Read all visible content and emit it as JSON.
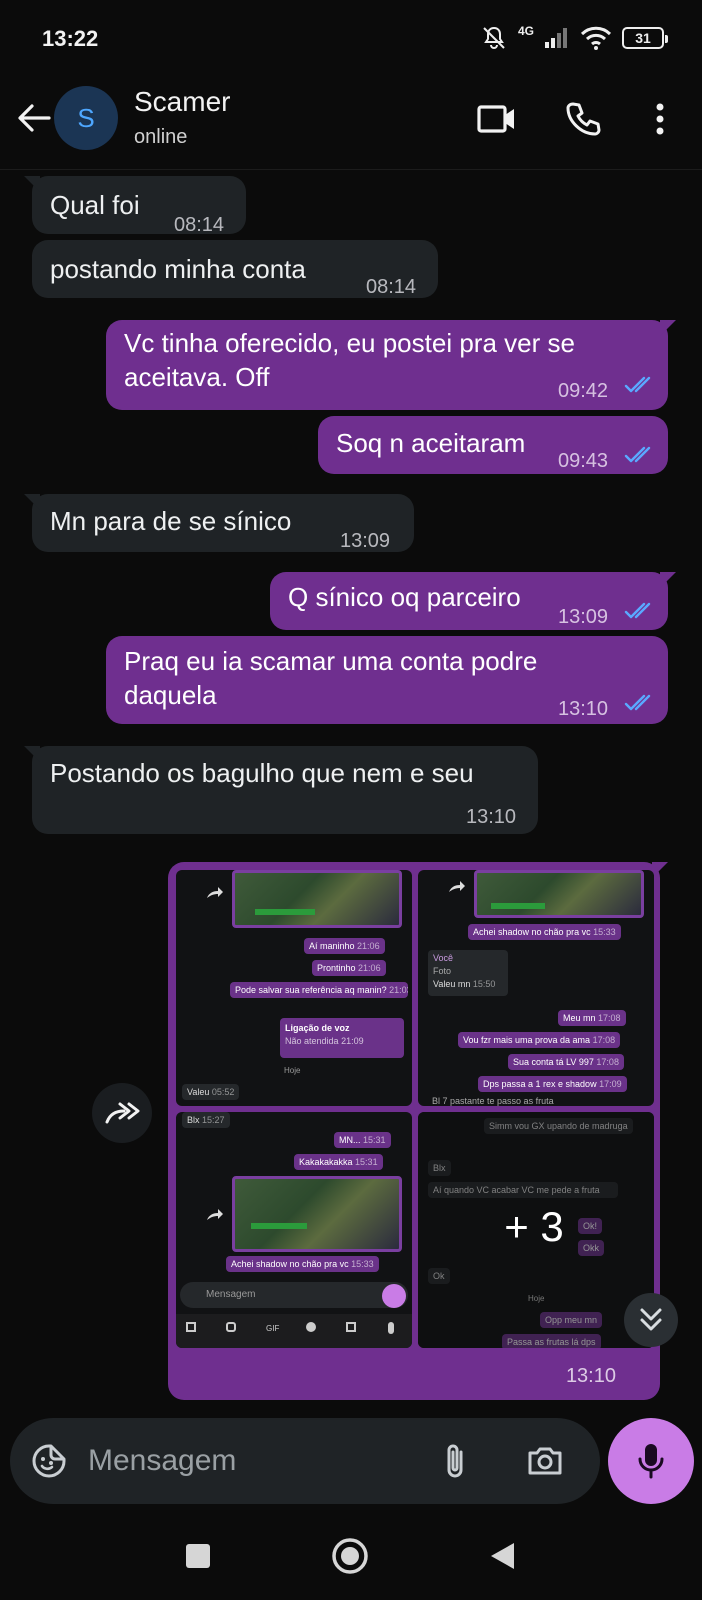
{
  "status_bar": {
    "time": "13:22",
    "network": "4G",
    "battery": "31"
  },
  "header": {
    "avatar_letter": "S",
    "name": "Scamer",
    "status": "online"
  },
  "messages": [
    {
      "dir": "in",
      "text": "Qual foi",
      "time": "08:14"
    },
    {
      "dir": "in",
      "text": "postando minha conta",
      "time": "08:14"
    },
    {
      "dir": "out",
      "text_line1": "Vc tinha oferecido, eu postei pra ver se",
      "text_line2": "aceitava. Off",
      "time": "09:42",
      "status": "read"
    },
    {
      "dir": "out",
      "text": "Soq n aceitaram",
      "time": "09:43",
      "status": "read"
    },
    {
      "dir": "in",
      "text": "Mn para de se sínico",
      "time": "13:09"
    },
    {
      "dir": "out",
      "text": "Q sínico oq parceiro",
      "time": "13:09",
      "status": "read"
    },
    {
      "dir": "out",
      "text_line1": "Praq eu ia scamar uma conta podre",
      "text_line2": "daquela",
      "time": "13:10",
      "status": "read"
    },
    {
      "dir": "in",
      "text": "Postando os bagulho que nem e seu",
      "time": "13:10"
    }
  ],
  "album": {
    "time": "13:10",
    "extra_count": "+ 3",
    "thumb1": {
      "msgs": [
        "Aí maninho",
        "Prontinho",
        "Pode salvar sua referência aq manin?"
      ],
      "times": [
        "21:06",
        "21:06",
        "21:03"
      ],
      "call_title": "Ligação de voz",
      "call_sub": "Não atendida",
      "call_time": "21:09",
      "day": "Hoje",
      "reply": "Valeu",
      "reply_time": "05:52"
    },
    "thumb2": {
      "caption": "Achei shadow no chão pra vc",
      "caption_time": "15:33",
      "quote_author": "Você",
      "quote_text": "Foto",
      "reply": "Valeu mn",
      "reply_time": "15:50",
      "msgs": [
        "Meu mn",
        "Vou fzr mais uma prova da ama",
        "Sua conta tá LV 997",
        "Dps passa a 1 rex e shadow"
      ],
      "times": [
        "17:08",
        "17:08",
        "17:08",
        "17:09"
      ],
      "footer": "Bl 7 pastante te passo as fruta"
    },
    "thumb3": {
      "top_in": "Blx",
      "top_time": "15:27",
      "msgs": [
        "MN...",
        "Kakakakakka"
      ],
      "times": [
        "15:31",
        "15:31"
      ],
      "caption": "Achei shadow no chão pra vc",
      "caption_time": "15:33",
      "composer_placeholder": "Mensagem",
      "kb_gif": "GIF"
    },
    "thumb4": {
      "msgs_in": [
        "Simm vou GX upando de madruga",
        "Blx",
        "Aí quando VC acabar VC me pede a fruta",
        "Ok"
      ],
      "msgs_out": [
        "Ok!",
        "Okk",
        "Opp meu mn",
        "Passa as frutas lá dps"
      ],
      "day": "Hoje"
    }
  },
  "composer": {
    "placeholder": "Mensagem"
  },
  "colors": {
    "outgoing": "#6f2f8f",
    "incoming": "#1f2326",
    "read_ticks": "#5aa9ff",
    "mic": "#c97ce6",
    "background": "#0b0b0b"
  },
  "icons": [
    "back-arrow-icon",
    "video-call-icon",
    "phone-icon",
    "more-vert-icon",
    "forward-icon",
    "double-chevron-down-icon",
    "sticker-icon",
    "attach-icon",
    "camera-icon",
    "mic-icon",
    "nav-recents-icon",
    "nav-home-icon",
    "nav-back-icon"
  ]
}
